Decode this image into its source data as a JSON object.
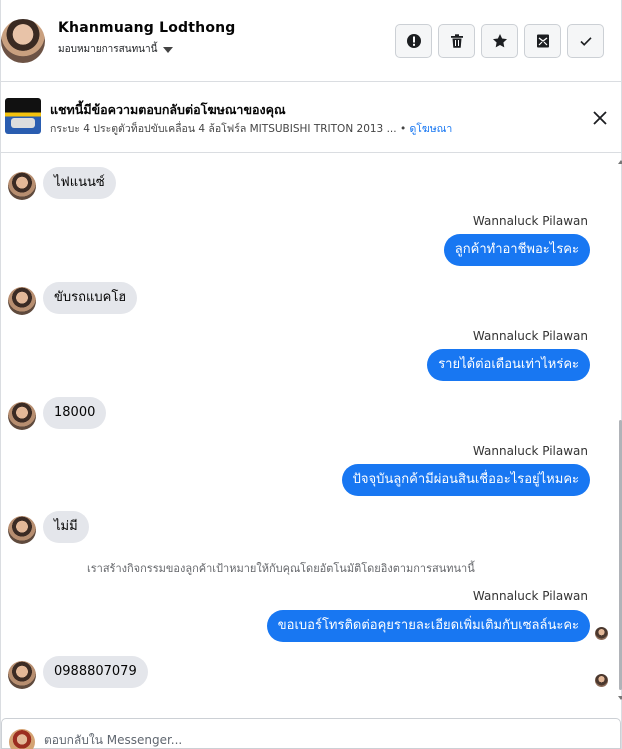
{
  "header": {
    "contact_name": "Khanmuang Lodthong",
    "assign_label": "มอบหมายการสนทนานี้",
    "actions": [
      {
        "icon": "alert-icon"
      },
      {
        "icon": "trash-icon"
      },
      {
        "icon": "star-icon"
      },
      {
        "icon": "mark-unread-icon"
      },
      {
        "icon": "check-icon"
      }
    ]
  },
  "ad_banner": {
    "title": "แชทนี้มีข้อความตอบกลับต่อโฆษณาของคุณ",
    "description": "กระบะ 4 ประตูตัวท็อปขับเคลื่อน 4 ล้อโฟร์ล MITSUBISHI TRITON 2013 ...",
    "link": "ดูโฆษณา"
  },
  "messages": [
    {
      "dir": "in",
      "text": "ไฟแนนซ์"
    },
    {
      "dir": "out",
      "sender": "Wannaluck Pilawan",
      "text": "ลูกค้าทำอาชีพอะไรคะ"
    },
    {
      "dir": "in",
      "text": "ขับรถแบคโฮ"
    },
    {
      "dir": "out",
      "sender": "Wannaluck Pilawan",
      "text": "รายได้ต่อเดือนเท่าไหร่คะ"
    },
    {
      "dir": "in",
      "text": "18000"
    },
    {
      "dir": "out",
      "sender": "Wannaluck Pilawan",
      "text": "ปัจจุบันลูกค้ามีผ่อนสินเชื่ออะไรอยู่ไหมคะ"
    },
    {
      "dir": "in",
      "text": "ไม่มี"
    },
    {
      "dir": "system",
      "text": "เราสร้างกิจกรรมของลูกค้าเป้าหมายให้กับคุณโดยอัตโนมัติโดยอิงตามการสนทนานี้"
    },
    {
      "dir": "out",
      "sender": "Wannaluck Pilawan",
      "text": "ขอเบอร์โทรติดต่อคุยรายละเอียดเพิ่มเติมกับเซลล์นะคะ"
    },
    {
      "dir": "in",
      "text": "0988807079"
    }
  ],
  "composer": {
    "placeholder": "ตอบกลับใน Messenger..."
  },
  "colors": {
    "outgoing_bubble": "#1877f2",
    "incoming_bubble": "#e4e6eb",
    "link": "#1877f2"
  }
}
